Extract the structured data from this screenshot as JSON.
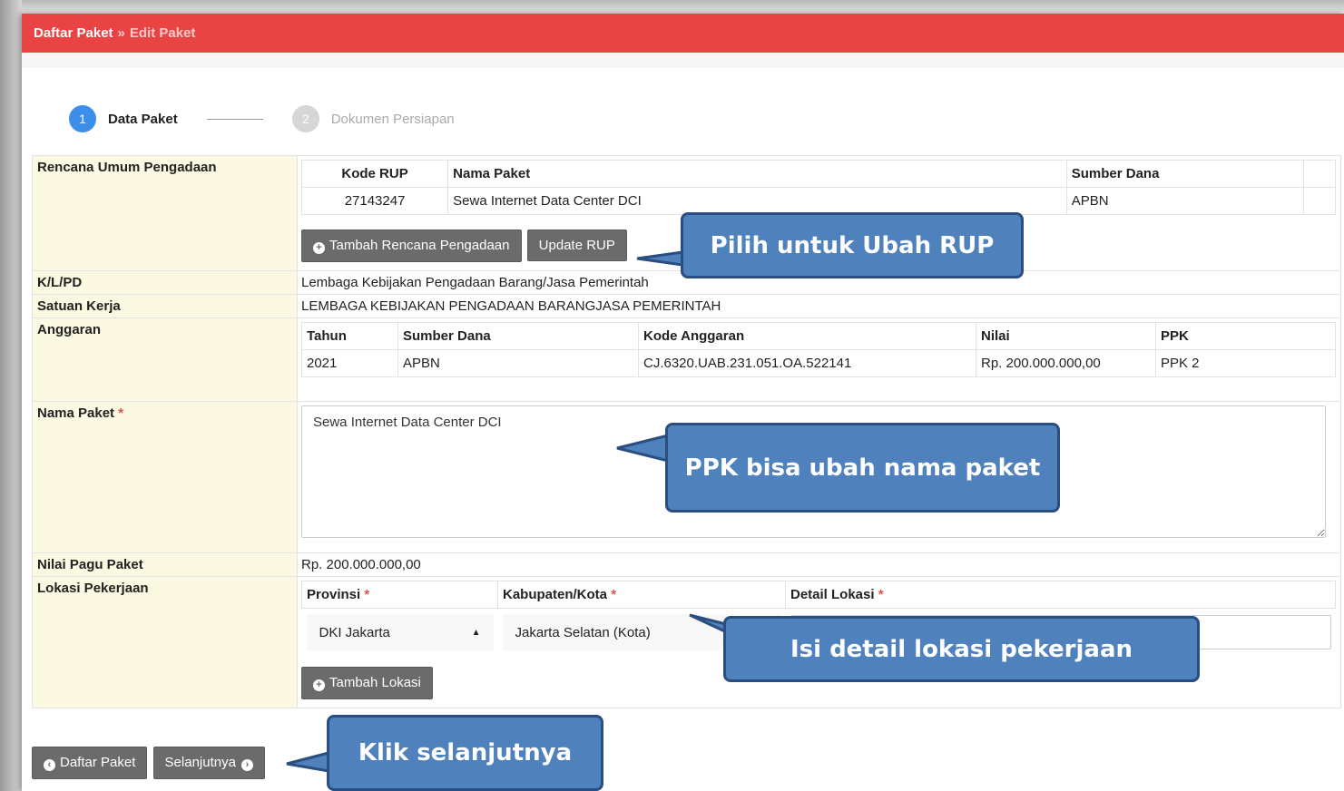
{
  "breadcrumb": {
    "root": "Daftar Paket",
    "separator": "»",
    "current": "Edit Paket"
  },
  "steps": [
    {
      "num": "1",
      "label": "Data Paket"
    },
    {
      "num": "2",
      "label": "Dokumen Persiapan"
    }
  ],
  "rup": {
    "label": "Rencana Umum Pengadaan",
    "headers": [
      "Kode RUP",
      "Nama Paket",
      "Sumber Dana"
    ],
    "row": [
      "27143247",
      "Sewa Internet Data Center DCI",
      "APBN"
    ],
    "btn_tambah": "Tambah Rencana Pengadaan",
    "btn_update": "Update RUP"
  },
  "klpd": {
    "label": "K/L/PD",
    "value": "Lembaga Kebijakan Pengadaan Barang/Jasa Pemerintah"
  },
  "satker": {
    "label": "Satuan Kerja",
    "value": "LEMBAGA KEBIJAKAN PENGADAAN BARANGJASA PEMERINTAH"
  },
  "anggaran": {
    "label": "Anggaran",
    "headers": [
      "Tahun",
      "Sumber Dana",
      "Kode Anggaran",
      "Nilai",
      "PPK"
    ],
    "row": [
      "2021",
      "APBN",
      "CJ.6320.UAB.231.051.OA.522141",
      "Rp. 200.000.000,00",
      "PPK 2"
    ]
  },
  "nama_paket": {
    "label": "Nama Paket",
    "required": "*",
    "value": "Sewa Internet Data Center DCI"
  },
  "pagu": {
    "label": "Nilai Pagu Paket",
    "value": "Rp. 200.000.000,00"
  },
  "lokasi": {
    "label": "Lokasi Pekerjaan",
    "headers": [
      "Provinsi",
      "Kabupaten/Kota",
      "Detail Lokasi"
    ],
    "required": "*",
    "provinsi": "DKI Jakarta",
    "kota": "Jakarta Selatan (Kota)",
    "btn_tambah": "Tambah Lokasi"
  },
  "footer": {
    "btn_back": "Daftar Paket",
    "btn_next": "Selanjutnya"
  },
  "callouts": {
    "rup": "Pilih untuk Ubah RUP",
    "nama": "PPK bisa ubah nama paket",
    "lokasi": "Isi detail lokasi pekerjaan",
    "next": "Klik selanjutnya"
  },
  "colors": {
    "header": "#e84444",
    "step_active": "#3d8ee8",
    "callout": "#4f81bd",
    "label_bg": "#fbf9e2"
  }
}
